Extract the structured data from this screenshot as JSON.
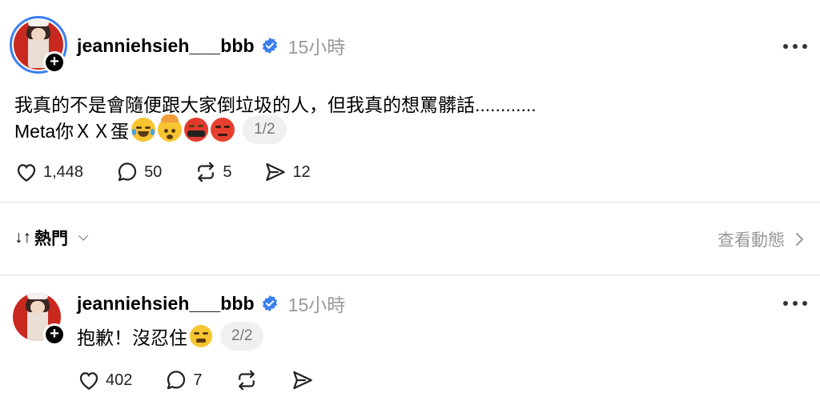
{
  "post1": {
    "username": "jeanniehsieh___bbb",
    "time": "15小時",
    "line1": "我真的不是會隨便跟大家倒垃圾的人，但我真的想罵髒話............",
    "line2": "Meta你ＸＸ蛋",
    "emojis": [
      "face-with-tears-of-joy",
      "exploding-head",
      "face-with-symbols-on-mouth",
      "pouting-face"
    ],
    "pager": "1/2",
    "likes": "1,448",
    "comments": "50",
    "reposts": "5",
    "shares": "12"
  },
  "sort": {
    "label": "熱門",
    "arrows": "↓↑",
    "activity": "查看動態"
  },
  "post2": {
    "username": "jeanniehsieh___bbb",
    "time": "15小時",
    "text": "抱歉！沒忍住",
    "emojis": [
      "persevering-face"
    ],
    "pager": "2/2",
    "likes": "402",
    "comments": "7"
  },
  "colors": {
    "verified": "#3b7ff0",
    "muted": "#999999",
    "divider": "#dcdcdc"
  }
}
